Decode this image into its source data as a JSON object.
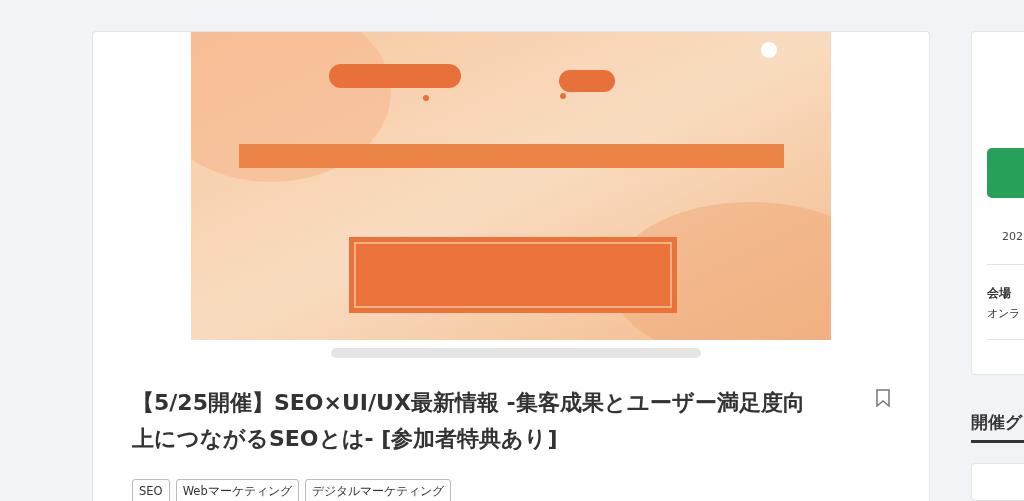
{
  "event": {
    "title": "【5/25開催】SEO×UI/UX最新情報 -集客成果とユーザー満足度向上につながるSEOとは- [参加者特典あり]",
    "bookmarked": false,
    "tags": [
      "SEO",
      "Webマーケティング",
      "デジタルマーケティング"
    ]
  },
  "sidebar": {
    "date": "202",
    "venue_label": "会場",
    "venue": "オンラ",
    "section_heading": "開催グ"
  }
}
